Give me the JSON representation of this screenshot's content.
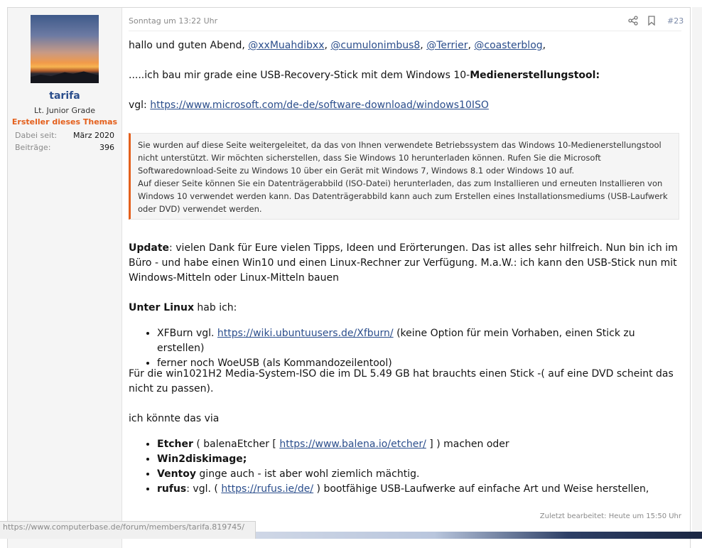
{
  "user": {
    "name": "tarifa",
    "title": "Lt. Junior Grade",
    "banner": "Ersteller dieses Themas",
    "stats": [
      {
        "label": "Dabei seit:",
        "value": "März 2020"
      },
      {
        "label": "Beiträge:",
        "value": "396"
      }
    ]
  },
  "post": {
    "date": "Sonntag um 13:22 Uhr",
    "number": "#23",
    "greeting": "hallo und guten Abend, ",
    "mentions": [
      "@xxMuahdibxx",
      "@cumulonimbus8",
      "@Terrier",
      "@coasterblog"
    ],
    "line2_pre": ".....ich bau mir grade eine USB-Recovery-Stick mit dem Windows 10-",
    "line2_bold": "Medienerstellungstool:",
    "vgl_label": "vgl: ",
    "vgl_link": "https://www.microsoft.com/de-de/software-download/windows10ISO",
    "quote": "Sie wurden auf diese Seite weitergeleitet, da das von Ihnen verwendete Betriebssystem das Windows 10-Medienerstellungstool nicht unterstützt. Wir möchten sicherstellen, dass Sie Windows 10 herunterladen können. Rufen Sie die Microsoft Softwaredownload-Seite zu Windows 10 über ein Gerät mit Windows 7, Windows 8.1 oder Windows 10 auf.",
    "quote2": "Auf dieser Seite können Sie ein Datenträgerabbild (ISO-Datei) herunterladen, das zum Installieren und erneuten Installieren von Windows 10 verwendet werden kann. Das Datenträgerabbild kann auch zum Erstellen eines Installationsmediums (USB-Laufwerk oder DVD) verwendet werden.",
    "update_bold": "Update",
    "update_text": ": vielen Dank für Eure vielen Tipps, Ideen und Erörterungen. Das ist alles sehr hilfreich. Nun bin ich im Büro - und habe einen Win10 und einen Linux-Rechner zur Verfügung. M.a.W.: ich kann den USB-Stick nun mit Windows-Mitteln oder Linux-Mitteln bauen",
    "linux_bold": "Unter Linux",
    "linux_text": " hab ich:",
    "linux_items": [
      {
        "pre": "XFBurn vgl. ",
        "link": "https://wiki.ubuntuusers.de/Xfburn/",
        "post": " (keine Option für mein Vorhaben, einen Stick zu erstellen)"
      },
      {
        "pre": "ferner noch WoeUSB (als Kommandozeilentool)",
        "link": "",
        "post": ""
      }
    ],
    "iso_text": "Für die win1021H2 Media-System-ISO die im DL 5.49 GB hat brauchts einen Stick -( auf eine DVD scheint das nicht zu passen).",
    "via_text": "ich könnte das via",
    "tools": [
      {
        "bold": "Etcher",
        "pre": " ( balenaEtcher [ ",
        "link": "https://www.balena.io/etcher/",
        "post": " ] ) machen oder"
      },
      {
        "bold": "Win2diskimage;",
        "pre": "",
        "link": "",
        "post": ""
      },
      {
        "bold": "Ventoy",
        "pre": " ginge auch - ist aber wohl ziemlich mächtig.",
        "link": "",
        "post": ""
      },
      {
        "bold": "rufus",
        "pre": ": vgl. ( ",
        "link": "https://rufus.ie/de/",
        "post": " ) bootfähige USB-Laufwerke auf einfache Art und Weise herstellen,"
      }
    ],
    "edited": "Zuletzt bearbeitet: Heute um 15:50 Uhr"
  },
  "status_bar": "https://www.computerbase.de/forum/members/tarifa.819745/"
}
